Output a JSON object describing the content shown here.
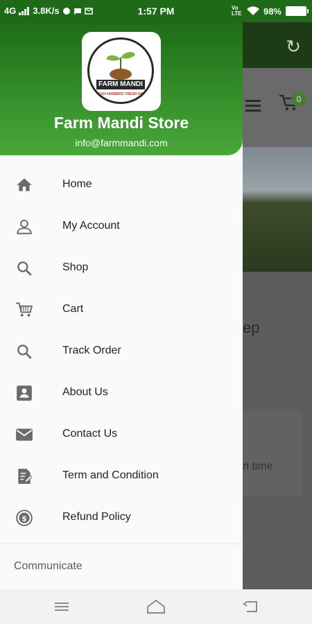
{
  "status_bar": {
    "network": "4G",
    "speed": "3.8K/s",
    "time": "1:57 PM",
    "volte": "Vo LTE",
    "battery": "98%"
  },
  "drawer": {
    "logo_text": "FARM MANDI",
    "logo_tagline": "FRESH FARMERS' FRESH INDIA",
    "store_name": "Farm Mandi Store",
    "email": "info@farmmandi.com",
    "items": [
      {
        "label": "Home",
        "icon": "home-icon"
      },
      {
        "label": "My Account",
        "icon": "user-icon"
      },
      {
        "label": "Shop",
        "icon": "search-icon"
      },
      {
        "label": "Cart",
        "icon": "cart-icon"
      },
      {
        "label": "Track Order",
        "icon": "search-icon"
      },
      {
        "label": "About Us",
        "icon": "contact-card-icon"
      },
      {
        "label": "Contact Us",
        "icon": "mail-icon"
      },
      {
        "label": "Term and Condition",
        "icon": "edit-document-icon"
      },
      {
        "label": "Refund Policy",
        "icon": "refund-icon"
      }
    ],
    "section_label": "Communicate"
  },
  "background": {
    "cart_count": "0",
    "heading_fragment": "ep",
    "text_fragment": "n time"
  },
  "colors": {
    "header_dark": "#1d6d17",
    "header_light": "#4aa83a"
  }
}
